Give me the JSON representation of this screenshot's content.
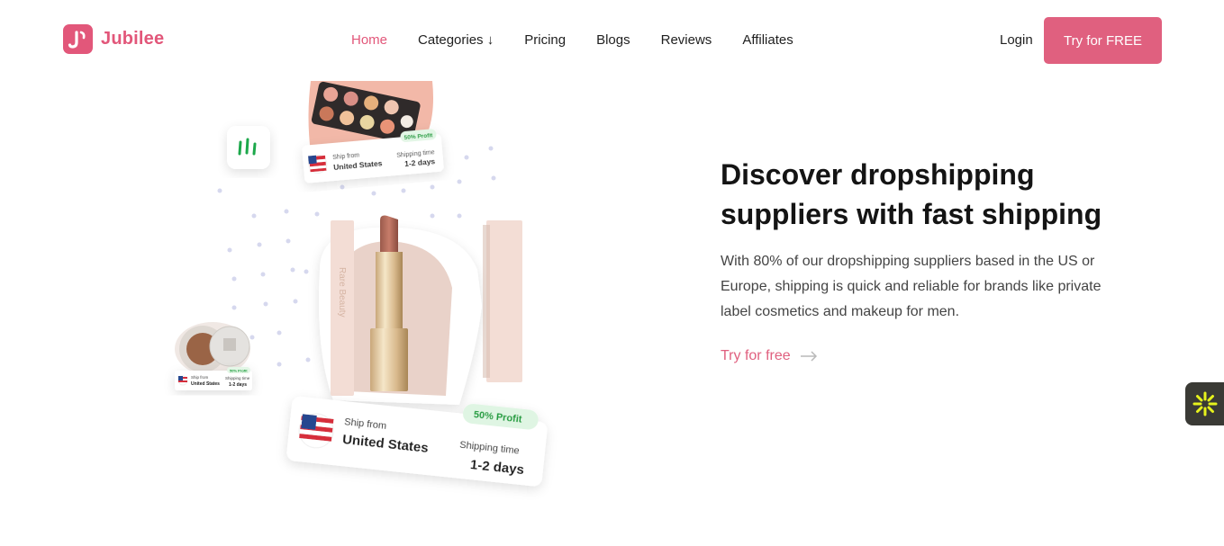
{
  "brand": {
    "name": "Jubilee"
  },
  "nav": {
    "items": [
      {
        "label": "Home",
        "active": true
      },
      {
        "label": "Categories ↓",
        "active": false
      },
      {
        "label": "Pricing",
        "active": false
      },
      {
        "label": "Blogs",
        "active": false
      },
      {
        "label": "Reviews",
        "active": false
      },
      {
        "label": "Affiliates",
        "active": false
      }
    ],
    "login": "Login",
    "cta": "Try for FREE"
  },
  "hero": {
    "title": "Discover dropshipping suppliers with fast shipping",
    "description": "With 80% of our dropshipping suppliers based in the US or Europe, shipping is quick and reliable for brands like private label cosmetics and makeup for men.",
    "link": "Try for free",
    "link_icon": "arrow-right-icon"
  },
  "product_cards": {
    "main": {
      "ship_from_label": "Ship from",
      "ship_from_value": "United States",
      "shipping_label": "Shipping time",
      "shipping_value": "1-2 days",
      "profit_badge": "50% Profit"
    },
    "top": {
      "ship_from_label": "Ship from",
      "ship_from_value": "United States",
      "shipping_label": "Shipping time",
      "shipping_value": "1-2 days",
      "profit_badge": "50% Profit"
    },
    "small": {
      "ship_from_label": "Ship from",
      "ship_from_value": "United States",
      "shipping_label": "Shipping time",
      "shipping_value": "1-2 days",
      "profit_badge": "50% Profit"
    },
    "lipstick_brand": "Rare Beauty"
  },
  "colors": {
    "accent": "#e0607f",
    "profit_green": "#1c9b3b",
    "widget_bg": "#3a3a35",
    "widget_icon": "#e6f21c"
  }
}
